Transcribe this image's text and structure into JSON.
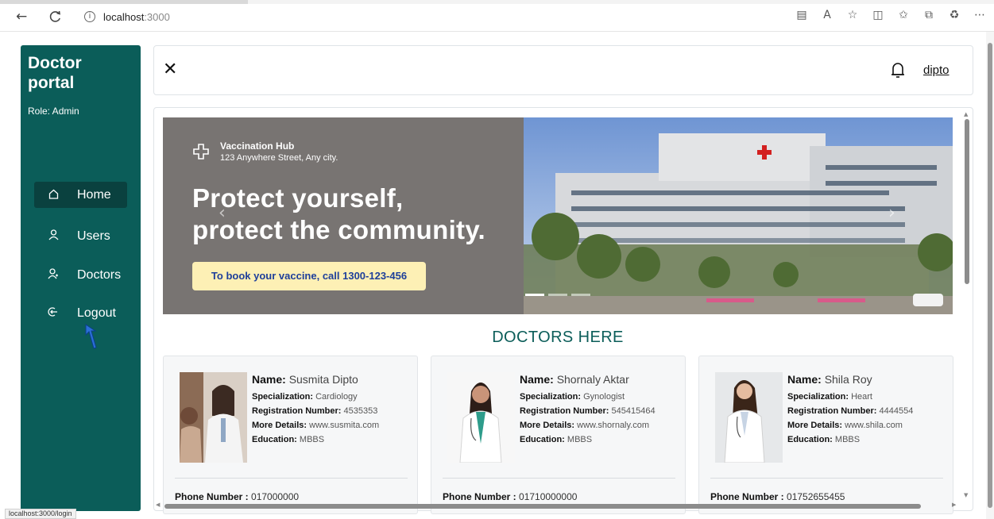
{
  "browser": {
    "back_icon": "←",
    "refresh_icon": "C",
    "url_host": "localhost",
    "url_port": ":3000",
    "toolbar_icons": [
      "reader-view-icon",
      "read-aloud-icon",
      "favorite-star-icon",
      "split-screen-icon",
      "favorites-icon",
      "collections-icon",
      "extensions-icon",
      "more-icon"
    ],
    "status_url": "localhost:3000/login"
  },
  "sidebar": {
    "brand": "Doctor portal",
    "brand_line1": "Doctor",
    "brand_line2": "portal",
    "role": "Role: Admin",
    "items": [
      {
        "label": "Home",
        "icon": "home-icon",
        "active": true
      },
      {
        "label": "Users",
        "icon": "user-icon",
        "active": false
      },
      {
        "label": "Doctors",
        "icon": "doctor-icon",
        "active": false
      },
      {
        "label": "Logout",
        "icon": "logout-icon",
        "active": false
      }
    ]
  },
  "header": {
    "close_label": "✕",
    "username": "dipto"
  },
  "banner": {
    "hub_name": "Vaccination Hub",
    "hub_address": "123 Anywhere Street, Any city.",
    "headline_line1": "Protect yourself,",
    "headline_line2": "protect the community.",
    "cta": "To book your vaccine, call 1300-123-456",
    "slide_count": 3,
    "active_slide": 1
  },
  "section_title": "DOCTORS HERE",
  "labels": {
    "name": "Name:",
    "specialization": "Specialization:",
    "registration": "Registration Number:",
    "more_details": "More Details:",
    "education": "Education:",
    "phone": "Phone Number :"
  },
  "doctors": [
    {
      "name": "Susmita Dipto",
      "specialization": "Cardiology",
      "registration": "4535353",
      "more_details": "www.susmita.com",
      "education": "MBBS",
      "phone": "017000000"
    },
    {
      "name": "Shornaly Aktar",
      "specialization": "Gynologist",
      "registration": "545415464",
      "more_details": "www.shornaly.com",
      "education": "MBBS",
      "phone": "01710000000"
    },
    {
      "name": "Shila Roy",
      "specialization": "Heart",
      "registration": "4444554",
      "more_details": "www.shila.com",
      "education": "MBBS",
      "phone": "01752655455"
    }
  ],
  "colors": {
    "sidebar_bg": "#0b5d59",
    "sidebar_active": "#0a413f",
    "accent_teal": "#0b5d59",
    "cta_bg": "#fdf0b5",
    "cta_text": "#1e3f9a"
  }
}
